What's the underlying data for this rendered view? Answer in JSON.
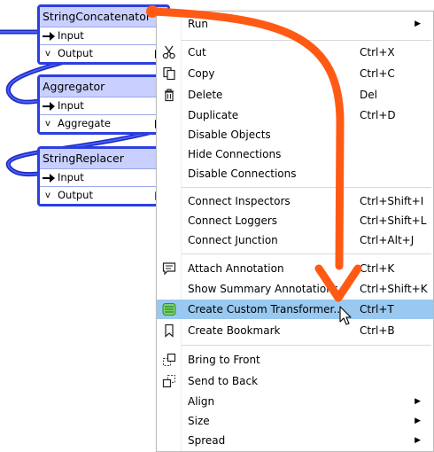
{
  "nodes": [
    {
      "title": "StringConcatenator",
      "ports": [
        "Input",
        "Output"
      ]
    },
    {
      "title": "Aggregator",
      "ports": [
        "Input",
        "Aggregate"
      ]
    },
    {
      "title": "StringReplacer",
      "ports": [
        "Input",
        "Output"
      ]
    }
  ],
  "menu": {
    "items": [
      {
        "label": "Run",
        "shortcut": "",
        "submenu": true,
        "icon": ""
      },
      {
        "label": "Cut",
        "shortcut": "Ctrl+X",
        "icon": "scissors-icon"
      },
      {
        "label": "Copy",
        "shortcut": "Ctrl+C",
        "icon": "copy-icon"
      },
      {
        "label": "Delete",
        "shortcut": "Del",
        "icon": "trash-icon"
      },
      {
        "label": "Duplicate",
        "shortcut": "Ctrl+D"
      },
      {
        "label": "Disable Objects",
        "shortcut": ""
      },
      {
        "label": "Hide Connections",
        "shortcut": ""
      },
      {
        "label": "Disable Connections",
        "shortcut": ""
      },
      {
        "label": "Connect Inspectors",
        "shortcut": "Ctrl+Shift+I"
      },
      {
        "label": "Connect Loggers",
        "shortcut": "Ctrl+Shift+L"
      },
      {
        "label": "Connect Junction",
        "shortcut": "Ctrl+Alt+J"
      },
      {
        "label": "Attach Annotation",
        "shortcut": "Ctrl+K",
        "icon": "annotation-icon"
      },
      {
        "label": "Show Summary Annotations",
        "shortcut": "Ctrl+Shift+K"
      },
      {
        "label": "Create Custom Transformer...",
        "shortcut": "Ctrl+T",
        "icon": "custom-transformer-icon",
        "highlighted": true
      },
      {
        "label": "Create Bookmark",
        "shortcut": "Ctrl+B",
        "icon": "bookmark-icon"
      },
      {
        "label": "Bring to Front",
        "shortcut": "",
        "icon": "bring-front-icon"
      },
      {
        "label": "Send to Back",
        "shortcut": "",
        "icon": "send-back-icon"
      },
      {
        "label": "Align",
        "shortcut": "",
        "submenu": true
      },
      {
        "label": "Size",
        "shortcut": "",
        "submenu": true
      },
      {
        "label": "Spread",
        "shortcut": "",
        "submenu": true
      }
    ]
  },
  "colors": {
    "annotation_arrow": "#ff5a14",
    "connection": "#2b3fe0",
    "highlight": "#99c8f0"
  }
}
